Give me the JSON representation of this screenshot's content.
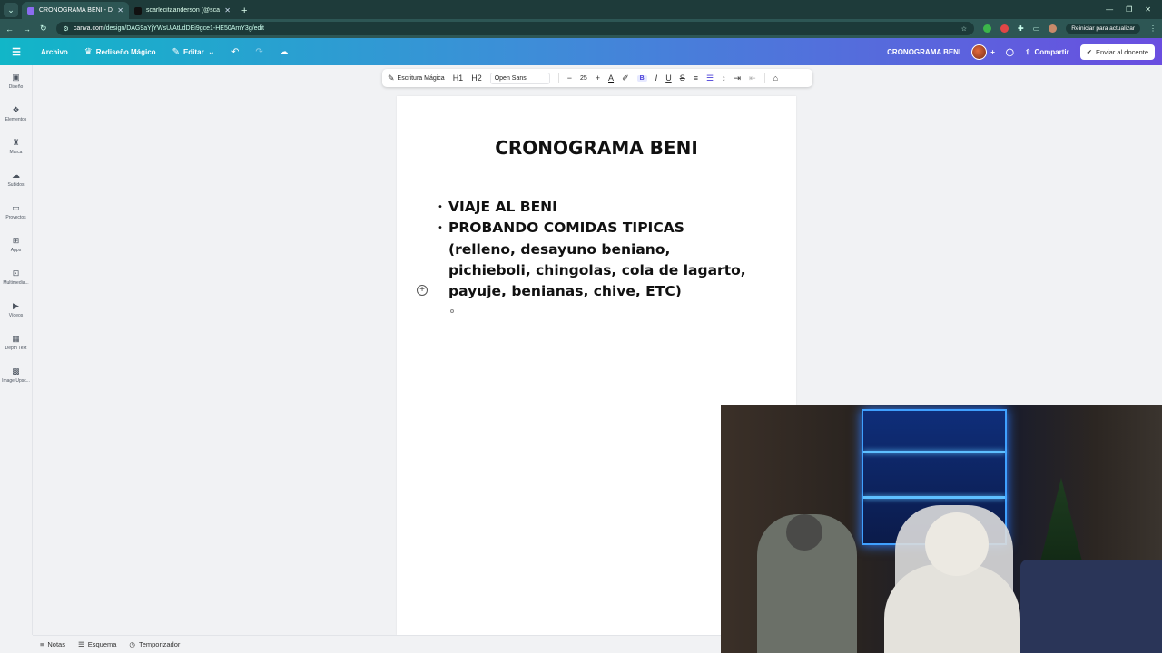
{
  "browser": {
    "tabs": [
      {
        "title": "CRONOGRAMA BENI - Doc",
        "active": true,
        "favicon_color": "#8b6cf0"
      },
      {
        "title": "scarlecitaanderson (@scarlehta",
        "active": false,
        "favicon_color": "#111111"
      }
    ],
    "url_host": "canva.com",
    "url_path": "/design/DAG9aYjYWsU/AtLdDEi9gce1-HE50AmY3g/edit",
    "restart_label": "Reiniciar para actualizar"
  },
  "canva": {
    "menu": {
      "file": "Archivo",
      "magic_resize": "Rediseño Mágico",
      "edit": "Editar"
    },
    "doc_name": "CRONOGRAMA BENI",
    "share": "Compartir",
    "send": "Enviar al docente"
  },
  "sidebar": {
    "items": [
      {
        "label": "Diseño",
        "icon": "layout-icon"
      },
      {
        "label": "Elementos",
        "icon": "elements-icon"
      },
      {
        "label": "Marca",
        "icon": "brand-icon"
      },
      {
        "label": "Subidos",
        "icon": "upload-icon"
      },
      {
        "label": "Proyectos",
        "icon": "folder-icon"
      },
      {
        "label": "Apps",
        "icon": "apps-icon"
      },
      {
        "label": "Multimedia...",
        "icon": "media-icon"
      },
      {
        "label": "Vídeos",
        "icon": "video-icon"
      },
      {
        "label": "Depth Text",
        "icon": "depth-text-icon"
      },
      {
        "label": "Image Upsc...",
        "icon": "image-upscale-icon"
      }
    ]
  },
  "toolbar": {
    "magic_write": "Escritura Mágica",
    "h1": "H1",
    "h2": "H2",
    "font": "Open Sans",
    "font_size": "25",
    "bold": "B",
    "italic": "I",
    "underline": "U",
    "strike": "S"
  },
  "document": {
    "title": "CRONOGRAMA BENI",
    "bullets": [
      "VIAJE AL BENI",
      "PROBANDO COMIDAS TIPICAS (relleno, desayuno beniano, pichieboli, chingolas, cola de lagarto, payuje, benianas, chive, ETC)"
    ]
  },
  "bottom": {
    "notes": "Notas",
    "outline": "Esquema",
    "timer": "Temporizador"
  },
  "colors": {
    "header_gradient_start": "#11b6c8",
    "header_gradient_end": "#6a4ee0",
    "browser_chrome": "#1e3b3a"
  }
}
